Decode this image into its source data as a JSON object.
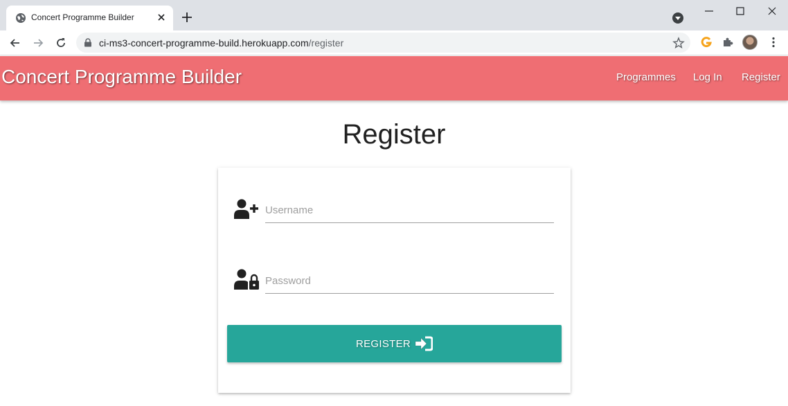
{
  "browser": {
    "tab_title": "Concert Programme Builder",
    "url_host": "ci-ms3-concert-programme-build.herokuapp.com",
    "url_path": "/register"
  },
  "site": {
    "brand": "Concert Programme Builder",
    "nav": [
      {
        "label": "Programmes"
      },
      {
        "label": "Log In"
      },
      {
        "label": "Register"
      }
    ],
    "navbar_color": "#ef6e73"
  },
  "form": {
    "title": "Register",
    "username": {
      "placeholder": "Username",
      "value": "",
      "icon": "user-plus-icon"
    },
    "password": {
      "placeholder": "Password",
      "value": "",
      "icon": "user-lock-icon"
    },
    "submit_label": "REGISTER",
    "submit_icon": "sign-in-icon",
    "submit_color": "#26a69a"
  }
}
